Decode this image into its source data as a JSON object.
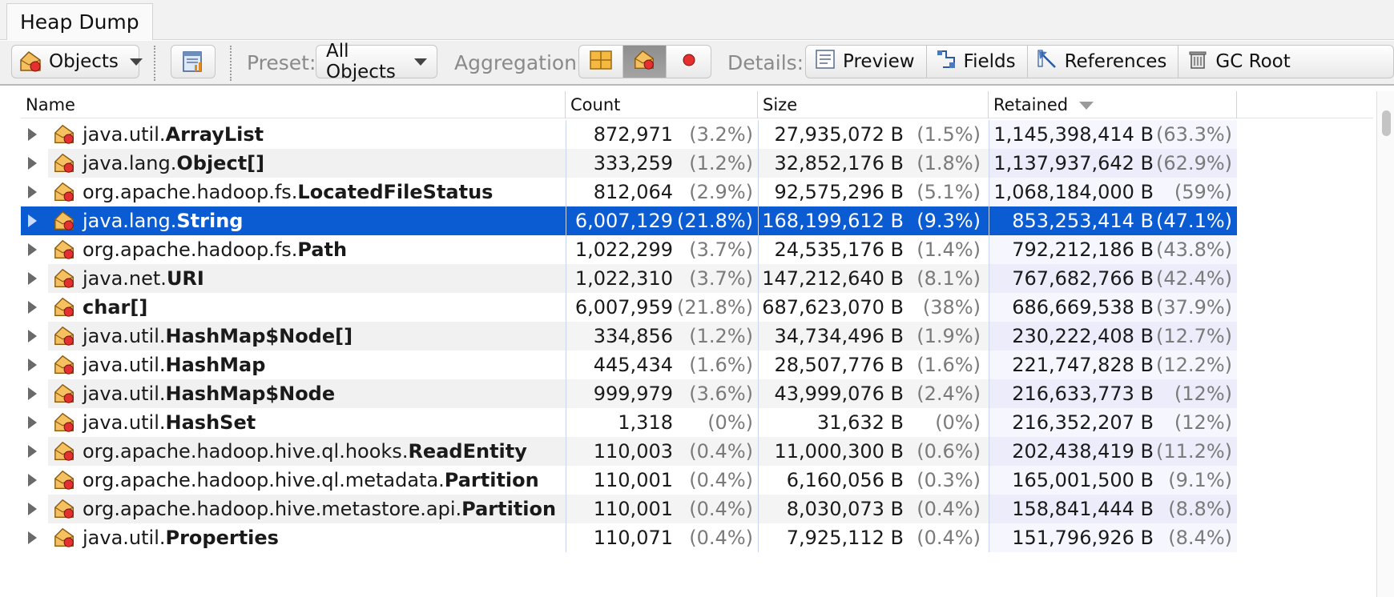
{
  "title": "Heap Dump",
  "toolbar": {
    "objects_label": "Objects",
    "preset_label": "Preset:",
    "preset_value": "All Objects",
    "aggregation_label": "Aggregation:",
    "details_label": "Details:",
    "details_buttons": {
      "preview": "Preview",
      "fields": "Fields",
      "references": "References",
      "gc_root": "GC Root"
    }
  },
  "columns": {
    "name": "Name",
    "count": "Count",
    "size": "Size",
    "retained": "Retained"
  },
  "colors": {
    "selection": "#0b5bd3",
    "icon_orange": "#f0a030",
    "icon_red": "#e53030"
  },
  "rows": [
    {
      "pkg": "java.util.",
      "cls": "ArrayList",
      "count": "872,971",
      "count_pct": "(3.2%)",
      "size": "27,935,072 B",
      "size_pct": "(1.5%)",
      "retained": "1,145,398,414 B",
      "retained_pct": "(63.3%)"
    },
    {
      "pkg": "java.lang.",
      "cls": "Object[]",
      "count": "333,259",
      "count_pct": "(1.2%)",
      "size": "32,852,176 B",
      "size_pct": "(1.8%)",
      "retained": "1,137,937,642 B",
      "retained_pct": "(62.9%)"
    },
    {
      "pkg": "org.apache.hadoop.fs.",
      "cls": "LocatedFileStatus",
      "count": "812,064",
      "count_pct": "(2.9%)",
      "size": "92,575,296 B",
      "size_pct": "(5.1%)",
      "retained": "1,068,184,000 B",
      "retained_pct": "(59%)"
    },
    {
      "pkg": "java.lang.",
      "cls": "String",
      "count": "6,007,129",
      "count_pct": "(21.8%)",
      "size": "168,199,612 B",
      "size_pct": "(9.3%)",
      "retained": "853,253,414 B",
      "retained_pct": "(47.1%)"
    },
    {
      "pkg": "org.apache.hadoop.fs.",
      "cls": "Path",
      "count": "1,022,299",
      "count_pct": "(3.7%)",
      "size": "24,535,176 B",
      "size_pct": "(1.4%)",
      "retained": "792,212,186 B",
      "retained_pct": "(43.8%)"
    },
    {
      "pkg": "java.net.",
      "cls": "URI",
      "count": "1,022,310",
      "count_pct": "(3.7%)",
      "size": "147,212,640 B",
      "size_pct": "(8.1%)",
      "retained": "767,682,766 B",
      "retained_pct": "(42.4%)"
    },
    {
      "pkg": "",
      "cls": "char[]",
      "count": "6,007,959",
      "count_pct": "(21.8%)",
      "size": "687,623,070 B",
      "size_pct": "(38%)",
      "retained": "686,669,538 B",
      "retained_pct": "(37.9%)"
    },
    {
      "pkg": "java.util.",
      "cls": "HashMap$Node[]",
      "count": "334,856",
      "count_pct": "(1.2%)",
      "size": "34,734,496 B",
      "size_pct": "(1.9%)",
      "retained": "230,222,408 B",
      "retained_pct": "(12.7%)"
    },
    {
      "pkg": "java.util.",
      "cls": "HashMap",
      "count": "445,434",
      "count_pct": "(1.6%)",
      "size": "28,507,776 B",
      "size_pct": "(1.6%)",
      "retained": "221,747,828 B",
      "retained_pct": "(12.2%)"
    },
    {
      "pkg": "java.util.",
      "cls": "HashMap$Node",
      "count": "999,979",
      "count_pct": "(3.6%)",
      "size": "43,999,076 B",
      "size_pct": "(2.4%)",
      "retained": "216,633,773 B",
      "retained_pct": "(12%)"
    },
    {
      "pkg": "java.util.",
      "cls": "HashSet",
      "count": "1,318",
      "count_pct": "(0%)",
      "size": "31,632 B",
      "size_pct": "(0%)",
      "retained": "216,352,207 B",
      "retained_pct": "(12%)"
    },
    {
      "pkg": "org.apache.hadoop.hive.ql.hooks.",
      "cls": "ReadEntity",
      "count": "110,003",
      "count_pct": "(0.4%)",
      "size": "11,000,300 B",
      "size_pct": "(0.6%)",
      "retained": "202,438,419 B",
      "retained_pct": "(11.2%)"
    },
    {
      "pkg": "org.apache.hadoop.hive.ql.metadata.",
      "cls": "Partition",
      "count": "110,001",
      "count_pct": "(0.4%)",
      "size": "6,160,056 B",
      "size_pct": "(0.3%)",
      "retained": "165,001,500 B",
      "retained_pct": "(9.1%)"
    },
    {
      "pkg": "org.apache.hadoop.hive.metastore.api.",
      "cls": "Partition",
      "count": "110,001",
      "count_pct": "(0.4%)",
      "size": "8,030,073 B",
      "size_pct": "(0.4%)",
      "retained": "158,841,444 B",
      "retained_pct": "(8.8%)"
    },
    {
      "pkg": "java.util.",
      "cls": "Properties",
      "count": "110,071",
      "count_pct": "(0.4%)",
      "size": "7,925,112 B",
      "size_pct": "(0.4%)",
      "retained": "151,796,926 B",
      "retained_pct": "(8.4%)"
    }
  ],
  "selected_row": 3
}
